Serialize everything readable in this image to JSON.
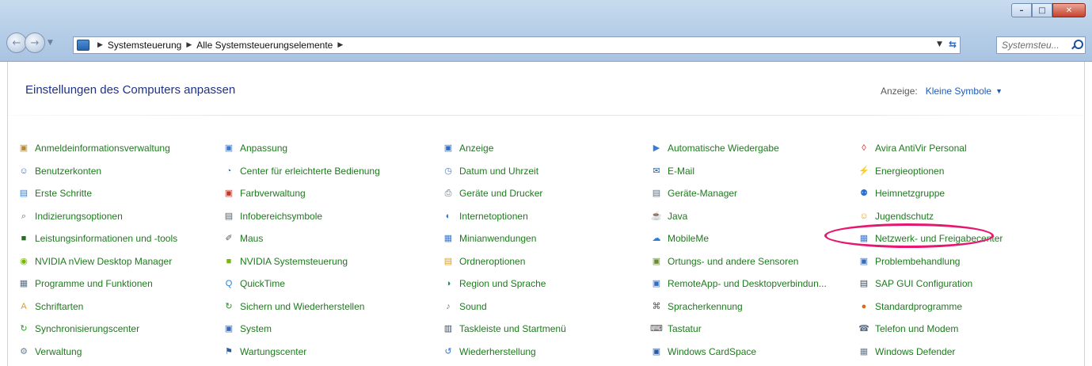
{
  "window": {
    "minimize_glyph": "–",
    "maximize_glyph": "□",
    "close_glyph": "✕"
  },
  "nav": {
    "back_glyph": "←",
    "forward_glyph": "→"
  },
  "breadcrumb": {
    "items": [
      "Systemsteuerung",
      "Alle Systemsteuerungselemente"
    ]
  },
  "search": {
    "value": "Systemsteu..."
  },
  "header": {
    "title": "Einstellungen des Computers anpassen",
    "view_label": "Anzeige:",
    "view_value": "Kleine Symbole"
  },
  "colors": {
    "link_green": "#1e7a1e",
    "title_blue": "#1e3287",
    "highlight": "#e5176f"
  },
  "items": {
    "col1": [
      {
        "label": "Anmeldeinformationsverwaltung",
        "icon": "vault-icon",
        "glyph": "▣",
        "color": "#b88a2a"
      },
      {
        "label": "Benutzerkonten",
        "icon": "users-icon",
        "glyph": "☺",
        "color": "#3a6bb8"
      },
      {
        "label": "Erste Schritte",
        "icon": "getting-started-icon",
        "glyph": "▤",
        "color": "#2f7fd0"
      },
      {
        "label": "Indizierungsoptionen",
        "icon": "indexing-icon",
        "glyph": "⌕",
        "color": "#5a6d80"
      },
      {
        "label": "Leistungsinformationen und -tools",
        "icon": "performance-icon",
        "glyph": "■",
        "color": "#2a6a2a"
      },
      {
        "label": "NVIDIA nView Desktop Manager",
        "icon": "nvidia-nview-icon",
        "glyph": "◉",
        "color": "#76b900"
      },
      {
        "label": "Programme und Funktionen",
        "icon": "programs-icon",
        "glyph": "▦",
        "color": "#5b6f85"
      },
      {
        "label": "Schriftarten",
        "icon": "fonts-icon",
        "glyph": "A",
        "color": "#d8a020"
      },
      {
        "label": "Synchronisierungscenter",
        "icon": "sync-center-icon",
        "glyph": "↻",
        "color": "#2a9a2a"
      },
      {
        "label": "Verwaltung",
        "icon": "admin-tools-icon",
        "glyph": "⚙",
        "color": "#6b7d92"
      }
    ],
    "col2": [
      {
        "label": "Anpassung",
        "icon": "personalization-icon",
        "glyph": "▣",
        "color": "#3a7bd5"
      },
      {
        "label": "Center für erleichterte Bedienung",
        "icon": "ease-of-access-icon",
        "glyph": "◔",
        "color": "#2a6fcf"
      },
      {
        "label": "Farbverwaltung",
        "icon": "color-management-icon",
        "glyph": "▣",
        "color": "#c0392b"
      },
      {
        "label": "Infobereichsymbole",
        "icon": "notification-icons-icon",
        "glyph": "▤",
        "color": "#55606e"
      },
      {
        "label": "Maus",
        "icon": "mouse-icon",
        "glyph": "✐",
        "color": "#555555"
      },
      {
        "label": "NVIDIA Systemsteuerung",
        "icon": "nvidia-control-panel-icon",
        "glyph": "■",
        "color": "#76b900"
      },
      {
        "label": "QuickTime",
        "icon": "quicktime-icon",
        "glyph": "Q",
        "color": "#2a7fd8"
      },
      {
        "label": "Sichern und Wiederherstellen",
        "icon": "backup-restore-icon",
        "glyph": "↻",
        "color": "#2a8a2a"
      },
      {
        "label": "System",
        "icon": "system-icon",
        "glyph": "▣",
        "color": "#3a6bb8"
      },
      {
        "label": "Wartungscenter",
        "icon": "action-center-icon",
        "glyph": "⚑",
        "color": "#2a5aa0"
      }
    ],
    "col3": [
      {
        "label": "Anzeige",
        "icon": "display-icon",
        "glyph": "▣",
        "color": "#2a6fcf"
      },
      {
        "label": "Datum und Uhrzeit",
        "icon": "date-time-icon",
        "glyph": "◷",
        "color": "#4a7ab5"
      },
      {
        "label": "Geräte und Drucker",
        "icon": "devices-printers-icon",
        "glyph": "⎙",
        "color": "#5a6d80"
      },
      {
        "label": "Internetoptionen",
        "icon": "internet-options-icon",
        "glyph": "◐",
        "color": "#2a7fd8"
      },
      {
        "label": "Minianwendungen",
        "icon": "gadgets-icon",
        "glyph": "▦",
        "color": "#3a7bd5"
      },
      {
        "label": "Ordneroptionen",
        "icon": "folder-options-icon",
        "glyph": "▤",
        "color": "#d8a020"
      },
      {
        "label": "Region und Sprache",
        "icon": "region-language-icon",
        "glyph": "◑",
        "color": "#2a8a5a"
      },
      {
        "label": "Sound",
        "icon": "sound-icon",
        "glyph": "♪",
        "color": "#6b7d92"
      },
      {
        "label": "Taskleiste und Startmenü",
        "icon": "taskbar-icon",
        "glyph": "▥",
        "color": "#3a4a5e"
      },
      {
        "label": "Wiederherstellung",
        "icon": "recovery-icon",
        "glyph": "↺",
        "color": "#2a6fcf"
      }
    ],
    "col4": [
      {
        "label": "Automatische Wiedergabe",
        "icon": "autoplay-icon",
        "glyph": "▶",
        "color": "#3a7bd5"
      },
      {
        "label": "E-Mail",
        "icon": "email-icon",
        "glyph": "✉",
        "color": "#2a5aa0"
      },
      {
        "label": "Geräte-Manager",
        "icon": "device-manager-icon",
        "glyph": "▤",
        "color": "#5a6d80"
      },
      {
        "label": "Java",
        "icon": "java-icon",
        "glyph": "☕",
        "color": "#c0392b"
      },
      {
        "label": "MobileMe",
        "icon": "mobileme-icon",
        "glyph": "☁",
        "color": "#2a7fd8"
      },
      {
        "label": "Ortungs- und andere Sensoren",
        "icon": "sensors-icon",
        "glyph": "▣",
        "color": "#6b8a3a"
      },
      {
        "label": "RemoteApp- und Desktopverbindun...",
        "icon": "remoteapp-icon",
        "glyph": "▣",
        "color": "#3a6bb8"
      },
      {
        "label": "Spracherkennung",
        "icon": "speech-recognition-icon",
        "glyph": "⌘",
        "color": "#555555"
      },
      {
        "label": "Tastatur",
        "icon": "keyboard-icon",
        "glyph": "⌨",
        "color": "#555555"
      },
      {
        "label": "Windows CardSpace",
        "icon": "cardspace-icon",
        "glyph": "▣",
        "color": "#2a5aa0"
      }
    ],
    "col5": [
      {
        "label": "Avira AntiVir Personal",
        "icon": "avira-icon",
        "glyph": "◊",
        "color": "#d42020"
      },
      {
        "label": "Energieoptionen",
        "icon": "power-options-icon",
        "glyph": "⚡",
        "color": "#2a8a2a"
      },
      {
        "label": "Heimnetzgruppe",
        "icon": "homegroup-icon",
        "glyph": "⚉",
        "color": "#2a6fcf"
      },
      {
        "label": "Jugendschutz",
        "icon": "parental-controls-icon",
        "glyph": "☺",
        "color": "#d8a020"
      },
      {
        "label": "Netzwerk- und Freigabecenter",
        "icon": "network-sharing-icon",
        "glyph": "▦",
        "color": "#3a7bd5"
      },
      {
        "label": "Problembehandlung",
        "icon": "troubleshooting-icon",
        "glyph": "▣",
        "color": "#3a6bb8"
      },
      {
        "label": "SAP GUI Configuration",
        "icon": "sap-gui-icon",
        "glyph": "▤",
        "color": "#3a4a5e"
      },
      {
        "label": "Standardprogramme",
        "icon": "default-programs-icon",
        "glyph": "●",
        "color": "#d86a20"
      },
      {
        "label": "Telefon und Modem",
        "icon": "phone-modem-icon",
        "glyph": "☎",
        "color": "#5a6d80"
      },
      {
        "label": "Windows Defender",
        "icon": "windows-defender-icon",
        "glyph": "▦",
        "color": "#6b7d92"
      }
    ]
  }
}
